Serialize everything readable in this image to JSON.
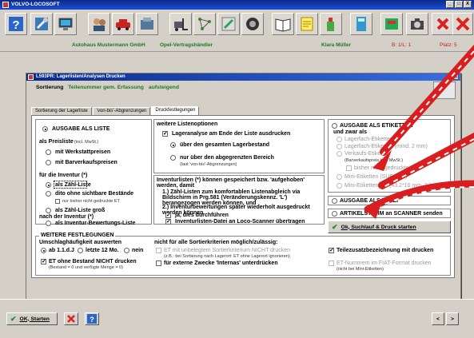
{
  "window": {
    "title": "VOLVO-LOCOSOFT",
    "controls": [
      "_",
      "□",
      "X"
    ]
  },
  "infobar": {
    "company": "Autohaus Mustermann GmbH",
    "dealer": "Opel-Vertragshändler",
    "user": "Klara Müller",
    "branch": "B: 1/L: 1",
    "place": "Platz: 5"
  },
  "dialog": {
    "title": "L593PR: Lagerlisten/Analysen Drucken",
    "sort_label": "Sortierung",
    "sort_value": "Teilenummer gem. Erfassung",
    "sort_dir": "aufsteigend",
    "tabs": [
      "Sortierung der Lagerliste",
      "'von-bis'-Abgrenzungen",
      "Druckfestlegungen"
    ]
  },
  "left": {
    "ausgabe_liste": "AUSGABE ALS LISTE",
    "preisliste": "als Preisliste",
    "preisliste_hint": "(incl. MwSt.)",
    "mit_werkstatt": "mit Werkstattpreisen",
    "mit_barverkauf": "mit Barverkaufspreisen",
    "fuer_inventur": "für die Inventur (*)",
    "als_zaehl": "als Zähl-Liste",
    "dito_ohne": "dito ohne sichtbare Bestände",
    "nur_bisher": "nur bisher nicht gedruckte ET",
    "als_zaehl_gross": "als Zähl-Liste groß",
    "nach_inventur": "nach der Inventur (*)",
    "als_bewertung": "als Inventur-Bewertungs-Liste"
  },
  "middle": {
    "weitere_opt": "weitere Listenoptionen",
    "lageranalyse": "Lageranalyse am Ende der Liste ausdrucken",
    "ueber_gesamten": "über den gesamten Lagerbestand",
    "nur_abgegrenzt": "nur über den abgegrenzten Bereich",
    "laut": "(laut 'von-bis'-Abgrenzungen)",
    "inv_head": "Inventurlisten (*) können gespeichert bzw. 'aufgehoben' werden, damit",
    "inv_1": "1.) Zähl-Listen zum komfortablen Listenabgleich via Bildschirm in Prg.581 (Veränderungskennz. 'L') herangezogen werden können, und",
    "inv_2": "2.) Inventurbewertungen später wiederholt ausgedruckt werden können",
    "ja_dies": "ja, dies durchführen",
    "inv_datei": "Inventurlisten-Datei an Loco-Scanner übertragen"
  },
  "right": {
    "ausgabe_etiketten": "AUSGABE ALS ETIKETTEN",
    "und_zwar": "und zwar als",
    "lagerfach_etik": "Lagerfach-Etiketten",
    "lagerfach_etik2": "Lagerfach-Etiketten (mind. 2 mm)",
    "verkaufs_etik": "Verkaufs-Etiketten",
    "barverkauf": "(Barverkaufspreis incl. MwSt.)",
    "bisher_nicht": "bisher nicht gedruckte",
    "mini_subaru": "Mini-Etiketten (SUBARU)",
    "mini_etik": "Mini-Etiketten",
    "mini_size": "(43.2*10 mm, 2-bahnig)",
    "ausgabe_datei": "AUSGABE ALS DATEI",
    "artikelstamm": "ARTIKELSTAMM an SCANNER senden",
    "ok_suchlauf": "Ok, Suchlauf & Druck starten"
  },
  "bottom": {
    "weitere_fest": "WEITERE FESTLEGUNGEN",
    "umschlag": "Umschlaghäufigkeit auswerten",
    "ab_11": "ab 1.1.d.J",
    "letzte_12": "letzte 12 Mo.",
    "nein": "nein",
    "nicht_fuer_alle": "nicht für alle Sortierkriterien möglich/zulässig:",
    "et_unbel": "ET mit unbelegtem Sortierkriterium NICHT drucken",
    "et_unbel_hint": "(z.B.: bei Sortierung nach Lagerort: ET ohne Lagerort ignorieren)",
    "externe": "für externe Zwecke 'Internas' unterdrücken",
    "et_ohne": "ET ohne Bestand NICHT drucken",
    "et_ohne_hint": "(Bestand = 0 und verfügte Menge = 0)",
    "teilezusatz": "Teilezusatzbezeichnung mit drucken",
    "et_fiat": "ET-Nummern im FIAT-Format drucken",
    "et_fiat_hint": "(nicht bei Mini-Etiketten)"
  },
  "footer": {
    "ok_starten": "OK, Starten",
    "nav_prev": "<",
    "nav_next": ">"
  },
  "colors": {
    "accent_green": "#1d7a25",
    "title_blue": "#0a2a8a",
    "arrow_red": "#d81e1e"
  }
}
